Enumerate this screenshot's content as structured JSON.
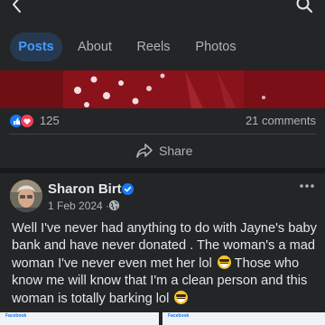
{
  "nav": {
    "back_icon": "back-arrow-icon",
    "search_icon": "search-icon"
  },
  "tabs": [
    {
      "label": "Posts",
      "active": true
    },
    {
      "label": "About",
      "active": false
    },
    {
      "label": "Reels",
      "active": false
    },
    {
      "label": "Photos",
      "active": false
    }
  ],
  "previous_post": {
    "reaction_icons": [
      "like-icon",
      "love-icon"
    ],
    "reaction_count": "125",
    "comments": "21 comments",
    "share_label": "Share"
  },
  "post": {
    "author": "Sharon Birt",
    "verified": true,
    "date": "1 Feb 2024 ·",
    "privacy_icon": "globe-icon",
    "text_part1": "Well I've never had anything to do with Jayne's baby bank and have never donated . The woman's a mad woman I've never even met her lol",
    "text_part2": "Those who know me will know that I'm a clean person and this woman is totally barking lol"
  },
  "thumbnails": [
    {
      "label": "Facebook"
    },
    {
      "label": "Facebook"
    }
  ],
  "colors": {
    "background": "#242526",
    "accent": "#4599ff",
    "tab_active_bg": "#263951",
    "verified": "#1877f2",
    "like": "#1877f2",
    "love": "#f33e58"
  }
}
